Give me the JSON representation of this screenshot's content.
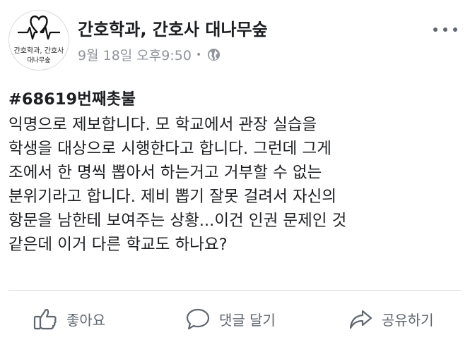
{
  "post": {
    "page_name": "간호학과, 간호사 대나무숲",
    "avatar": {
      "line1": "간호학과, 간호사",
      "line2": "대나무숲"
    },
    "timestamp": "9월 18일 오후9:50",
    "separator": "•",
    "hashtag": "#68619번째촛불",
    "body_lines": [
      "익명으로 제보합니다. 모 학교에서 관장 실습을",
      "학생을 대상으로 시행한다고 합니다. 그런데 그게",
      "조에서 한 명씩 뽑아서 하는거고 거부할 수 없는",
      "분위기라고 합니다. 제비 뽑기 잘못 걸려서 자신의",
      "항문을 남한테 보여주는 상황...이건 인권 문제인 것",
      "같은데 이거 다른 학교도 하나요?"
    ]
  },
  "actions": {
    "like_label": "좋아요",
    "comment_label": "댓글 달기",
    "share_label": "공유하기"
  },
  "icons": {
    "more": "more-dots-icon",
    "globe": "globe-icon",
    "like": "thumbs-up-icon",
    "comment": "comment-icon",
    "share": "share-arrow-icon"
  },
  "colors": {
    "text": "#1c1e21",
    "meta": "#90949c",
    "action": "#606770",
    "divider": "#dadde1"
  }
}
